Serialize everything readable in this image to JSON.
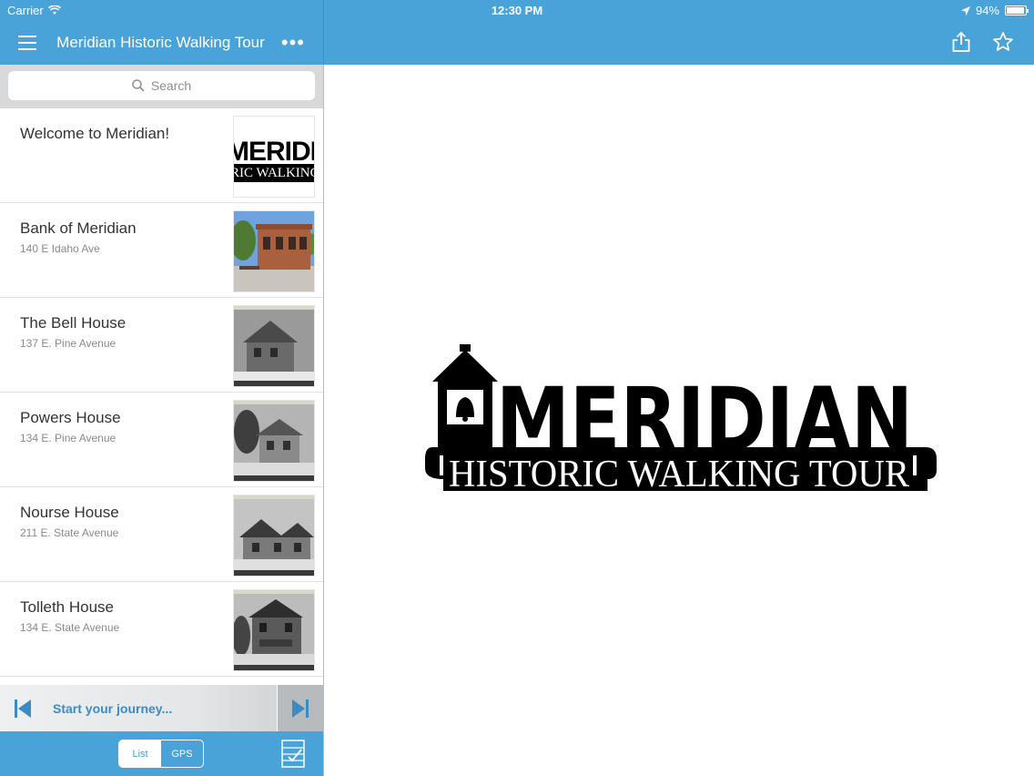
{
  "status_bar": {
    "carrier": "Carrier",
    "time": "12:30 PM",
    "battery": "94%",
    "battery_level": 0.94
  },
  "nav": {
    "title": "Meridian Historic Walking Tour",
    "more_label": "•••"
  },
  "search": {
    "placeholder": "Search"
  },
  "list": {
    "items": [
      {
        "title": "Welcome to Meridian!",
        "subtitle": "",
        "thumb_top": "MERIDI",
        "thumb_bottom": "RIC WALKING"
      },
      {
        "title": "Bank of Meridian",
        "subtitle": "140 E Idaho Ave"
      },
      {
        "title": "The Bell House",
        "subtitle": "137 E. Pine Avenue"
      },
      {
        "title": "Powers House",
        "subtitle": "134 E. Pine Avenue"
      },
      {
        "title": "Nourse House",
        "subtitle": "211 E. State Avenue"
      },
      {
        "title": "Tolleth House",
        "subtitle": "134 E. State Avenue"
      }
    ]
  },
  "journey": {
    "label": "Start your journey..."
  },
  "bottom_bar": {
    "list_label": "List",
    "gps_label": "GPS"
  },
  "logo": {
    "line1": "MERIDIAN",
    "line2": "HISTORIC WALKING TOUR"
  },
  "colors": {
    "accent": "#4aa3d8",
    "journey_text": "#3a8cc3"
  }
}
